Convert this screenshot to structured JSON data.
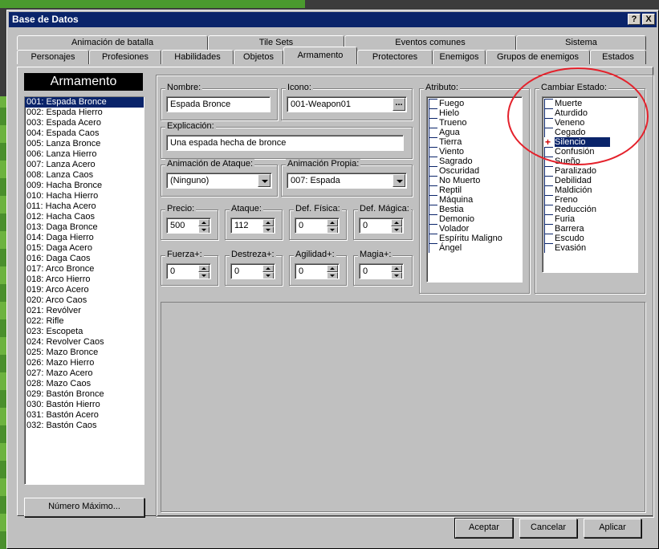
{
  "window": {
    "title": "Base de Datos",
    "help_btn": "?",
    "close_btn": "X"
  },
  "tabs_row1": [
    "Animación de batalla",
    "Tile Sets",
    "Eventos comunes",
    "Sistema"
  ],
  "tabs_row2": [
    "Personajes",
    "Profesiones",
    "Habilidades",
    "Objetos",
    "Armamento",
    "Protectores",
    "Enemigos",
    "Grupos de enemigos",
    "Estados"
  ],
  "left": {
    "header": "Armamento",
    "items": [
      "001: Espada Bronce",
      "002: Espada Hierro",
      "003: Espada Acero",
      "004: Espada Caos",
      "005: Lanza Bronce",
      "006: Lanza Hierro",
      "007: Lanza Acero",
      "008: Lanza Caos",
      "009: Hacha Bronce",
      "010: Hacha Hierro",
      "011: Hacha Acero",
      "012: Hacha Caos",
      "013: Daga Bronce",
      "014: Daga Hierro",
      "015: Daga Acero",
      "016: Daga Caos",
      "017: Arco Bronce",
      "018: Arco Hierro",
      "019: Arco Acero",
      "020: Arco Caos",
      "021: Revólver",
      "022: Rifle",
      "023: Escopeta",
      "024: Revolver Caos",
      "025: Mazo Bronce",
      "026: Mazo Hierro",
      "027: Mazo Acero",
      "028: Mazo Caos",
      "029: Bastón Bronce",
      "030: Bastón Hierro",
      "031: Bastón Acero",
      "032: Bastón Caos"
    ],
    "max_button": "Número Máximo..."
  },
  "form": {
    "nombre_label": "Nombre:",
    "nombre": "Espada Bronce",
    "icono_label": "Icono:",
    "icono": "001-Weapon01",
    "icono_btn": "...",
    "explicacion_label": "Explicación:",
    "explicacion": "Una espada hecha de bronce",
    "anim_ataque_label": "Animación de Ataque:",
    "anim_ataque": "(Ninguno)",
    "anim_propia_label": "Animación Propia:",
    "anim_propia": "007: Espada",
    "precio_label": "Precio:",
    "precio": "500",
    "ataque_label": "Ataque:",
    "ataque": "112",
    "def_fisica_label": "Def. Física:",
    "def_fisica": "0",
    "def_magica_label": "Def. Mágica:",
    "def_magica": "0",
    "fuerza_label": "Fuerza+:",
    "fuerza": "0",
    "destreza_label": "Destreza+:",
    "destreza": "0",
    "agilidad_label": "Agilidad+:",
    "agilidad": "0",
    "magia_label": "Magia+:",
    "magia": "0"
  },
  "atributo": {
    "label": "Atributo:",
    "items": [
      "Fuego",
      "Hielo",
      "Trueno",
      "Agua",
      "Tierra",
      "Viento",
      "Sagrado",
      "Oscuridad",
      "No Muerto",
      "Reptil",
      "Máquina",
      "Bestia",
      "Demonio",
      "Volador",
      "Espíritu Maligno",
      "Ángel"
    ]
  },
  "estado": {
    "label": "Cambiar Estado:",
    "items": [
      "Muerte",
      "Aturdido",
      "Veneno",
      "Cegado",
      "Silencio",
      "Confusión",
      "Sueño",
      "Paralizado",
      "Debilidad",
      "Maldición",
      "Freno",
      "Reducción",
      "Furia",
      "Barrera",
      "Escudo",
      "Evasión"
    ],
    "selected_index": 4,
    "plus_mark": "+"
  },
  "buttons": {
    "ok": "Aceptar",
    "cancel": "Cancelar",
    "apply": "Aplicar"
  }
}
